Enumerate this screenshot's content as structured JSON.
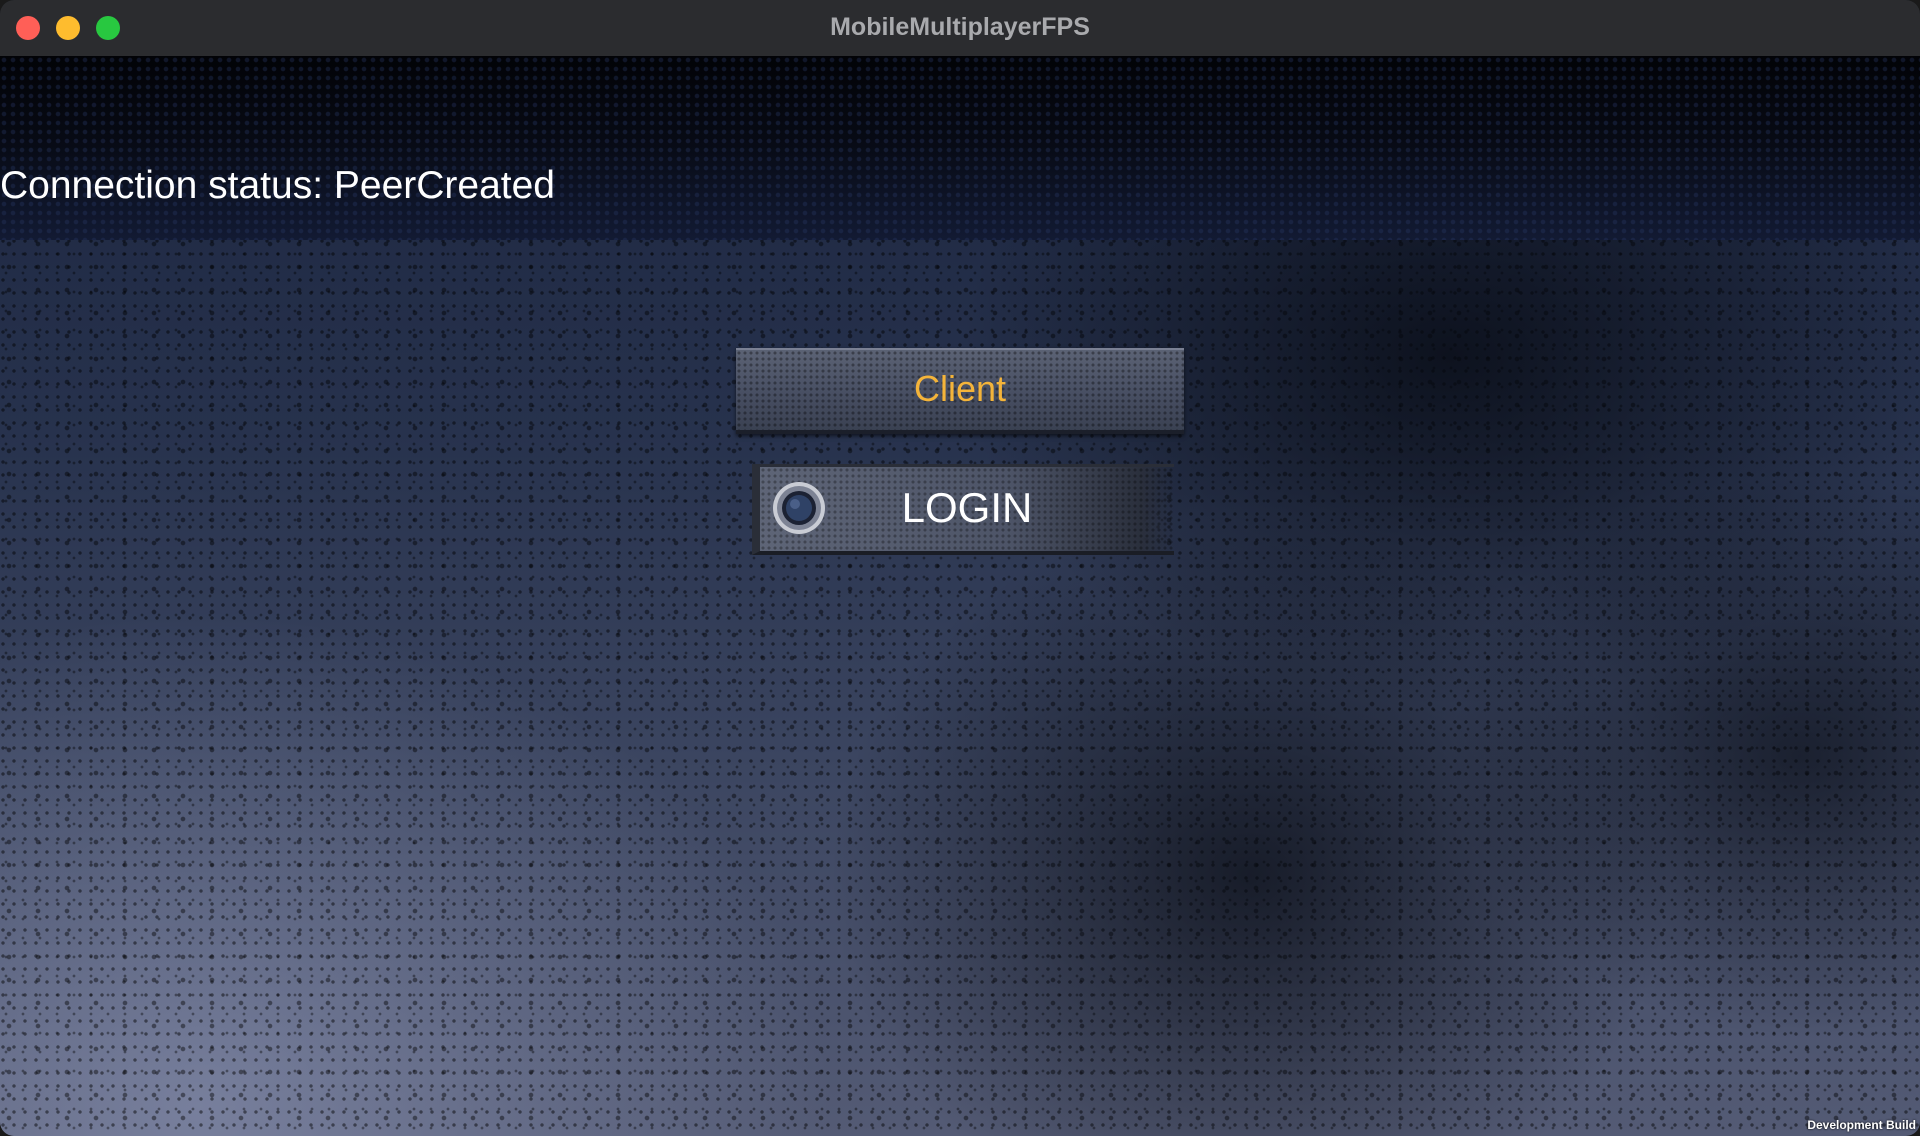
{
  "window": {
    "title": "MobileMultiplayerFPS",
    "traffic_lights": {
      "close_color": "#ff5f57",
      "minimize_color": "#febc2e",
      "zoom_color": "#28c840"
    }
  },
  "status": {
    "text": "Connection status: PeerCreated"
  },
  "buttons": {
    "client_label": "Client",
    "client_text_color": "#f4b43a",
    "login_label": "LOGIN",
    "login_icon": "bullet-hole-icon"
  },
  "footer": {
    "dev_build": "Development Build"
  }
}
